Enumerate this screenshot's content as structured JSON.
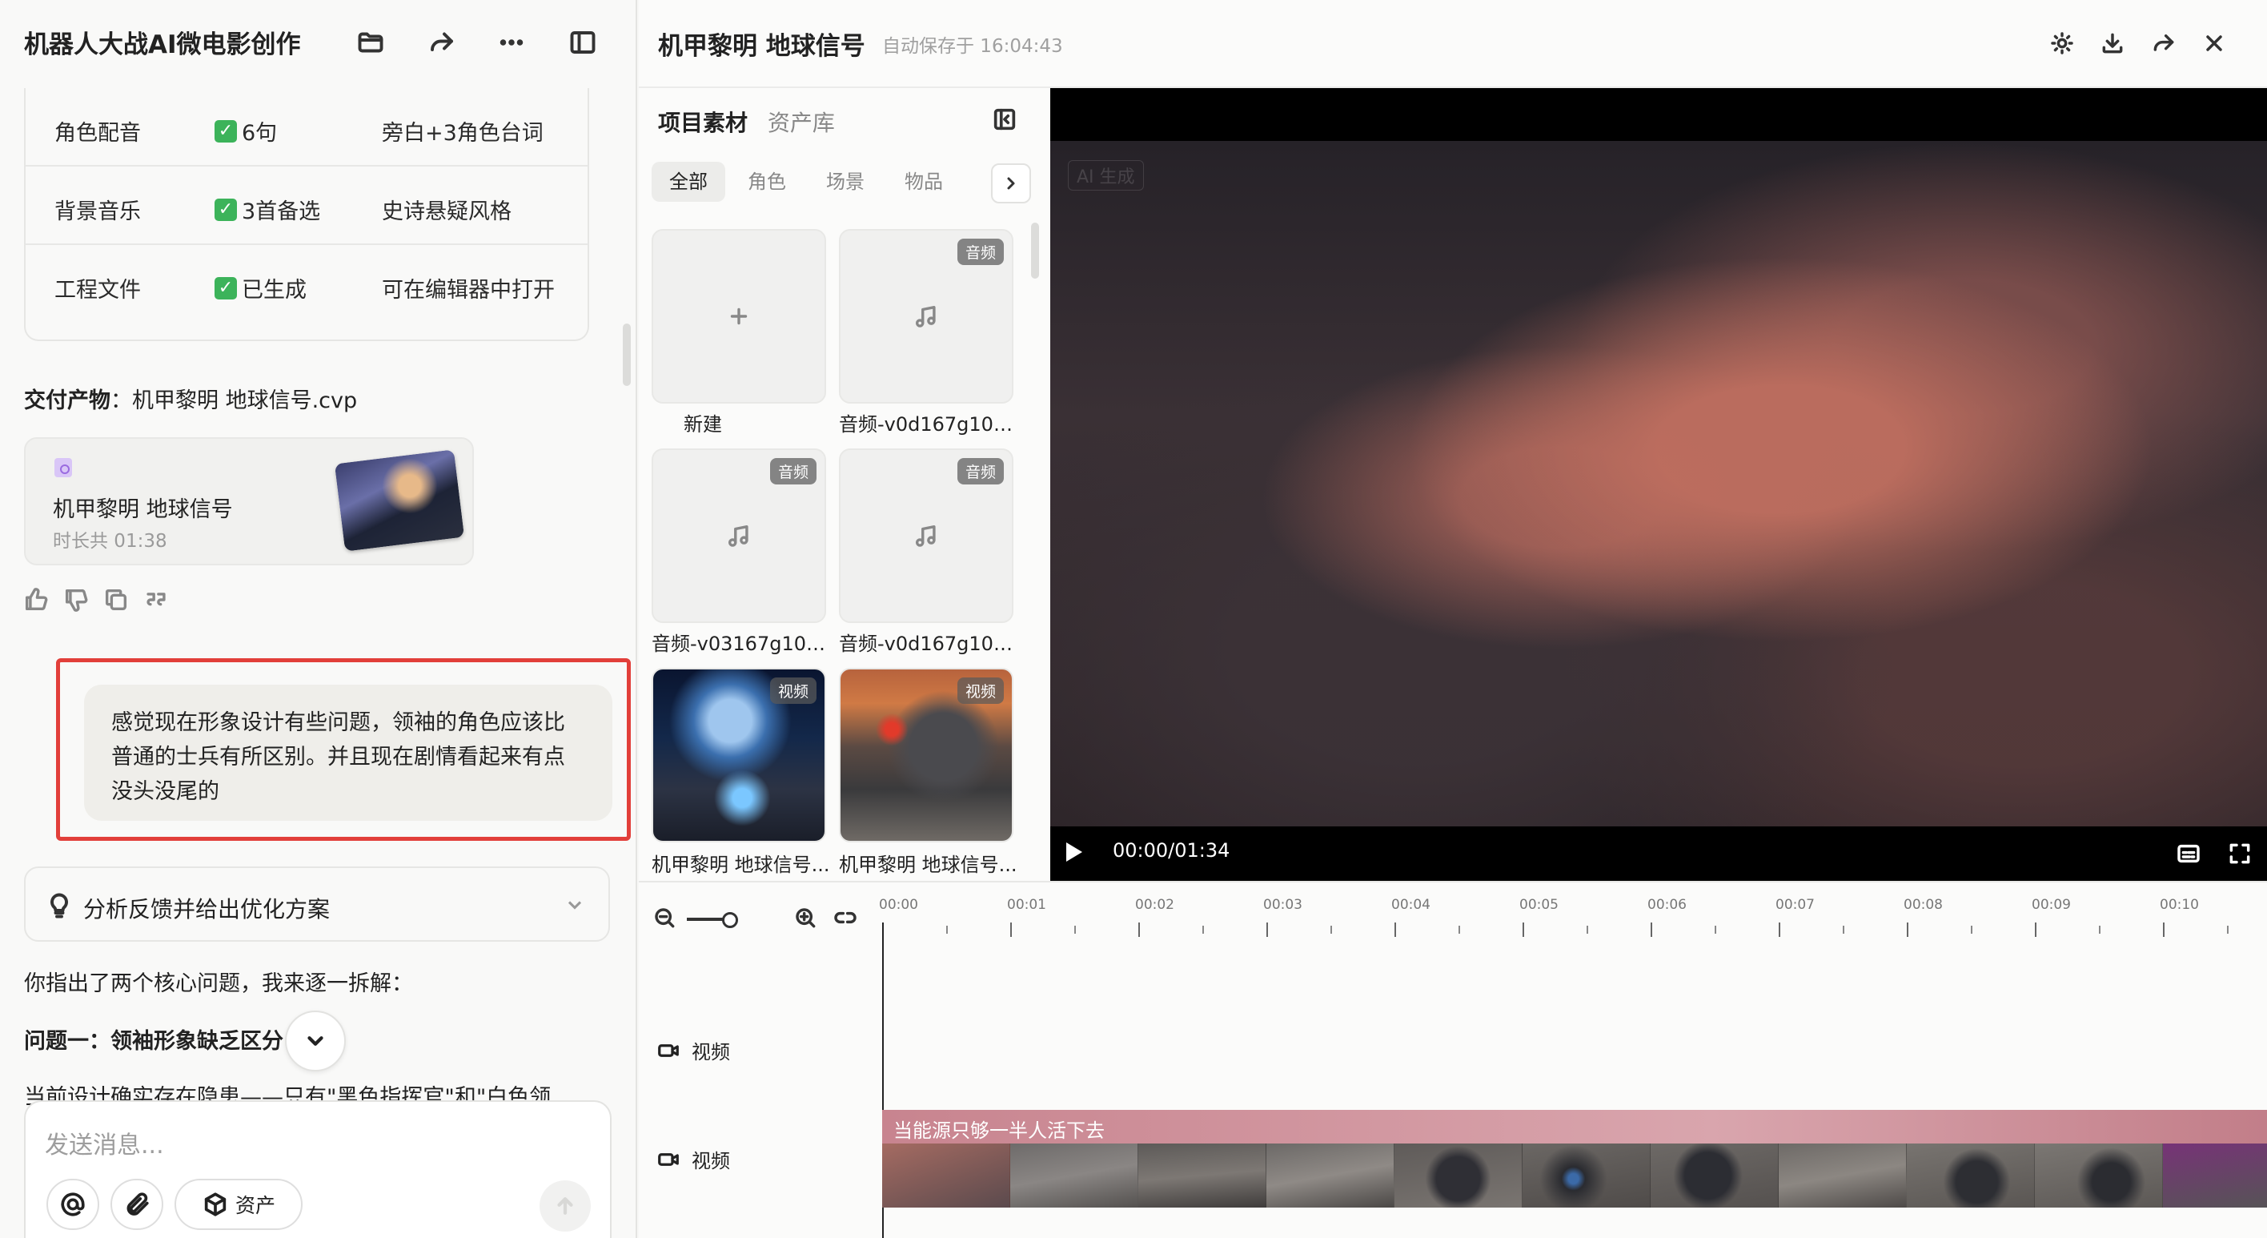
{
  "chat": {
    "title": "机器人大战AI微电影创作",
    "table_rows": [
      {
        "item": "角色配音",
        "status": "6句",
        "note": "旁白+3角色台词"
      },
      {
        "item": "背景音乐",
        "status": "3首备选",
        "note": "史诗悬疑风格"
      },
      {
        "item": "工程文件",
        "status": "已生成",
        "note": "可在编辑器中打开"
      }
    ],
    "deliverable_label": "交付产物",
    "deliverable_file": "机甲黎明 地球信号.cvp",
    "file_card": {
      "name": "机甲黎明 地球信号",
      "duration": "时长共 01:38"
    },
    "user_message": [
      "感觉现在形象设计有些问题，领袖的角色应该比",
      "普通的士兵有所区别。并且现在剧情看起来有点",
      "没头没尾的"
    ],
    "analysis_label": "分析反馈并给出优化方案",
    "reply_intro": "你指出了两个核心问题，我来逐一拆解：",
    "reply_issue1": "问题一：领袖形象缺乏区分",
    "reply_partial": "当前设计确实存在隐患——只有\"黑色指挥官\"和\"白色领",
    "composer_placeholder": "发送消息...",
    "assets_button": "资产"
  },
  "editor": {
    "project_title": "机甲黎明 地球信号",
    "autosave": "自动保存于 16:04:43",
    "panel_tabs": [
      "项目素材",
      "资产库"
    ],
    "filters": [
      "全部",
      "角色",
      "场景",
      "物品"
    ],
    "active_filter": "全部",
    "assets": [
      {
        "kind": "new",
        "label": "新建",
        "badge": ""
      },
      {
        "kind": "audio",
        "label": "音频-v0d167g100...",
        "badge": "音频"
      },
      {
        "kind": "audio",
        "label": "音频-v03167g100...",
        "badge": "音频"
      },
      {
        "kind": "audio",
        "label": "音频-v0d167g100...",
        "badge": "音频"
      },
      {
        "kind": "video-space",
        "label": "机甲黎明 地球信号...",
        "badge": "视频"
      },
      {
        "kind": "video-mech",
        "label": "机甲黎明 地球信号...",
        "badge": "视频"
      }
    ],
    "player": {
      "watermark": "AI 生成",
      "timecode": "00:00/01:34"
    },
    "timeline": {
      "ticks": [
        "00:00",
        "00:01",
        "00:02",
        "00:03",
        "00:04",
        "00:05",
        "00:06",
        "00:07",
        "00:08",
        "00:09",
        "00:10"
      ],
      "tracks": [
        "视频",
        "视频"
      ],
      "clip_caption": "当能源只够一半人活下去"
    }
  },
  "colors": {
    "highlight_border": "#e23f3a",
    "check_green": "#3cb35a",
    "clip_bar": "#c8848f"
  }
}
